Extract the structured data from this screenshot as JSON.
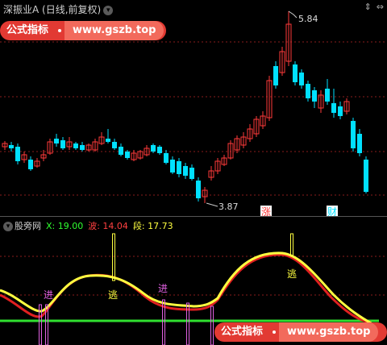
{
  "header": {
    "title": "深振业A (日线,前复权)",
    "chevron": "chevron-down-icon",
    "corner_icons": [
      "collapse-arrows-icon",
      "close-arrows-icon"
    ]
  },
  "promo": {
    "label": "公式指标",
    "url": "www.gszb.top"
  },
  "promo_bottom": {
    "label": "公式指标",
    "url": "www.gszb.top"
  },
  "price_panel": {
    "high_label": "5.84",
    "low_label": "3.87",
    "signals": [
      "涨",
      "财"
    ]
  },
  "indicator": {
    "name": "股旁网",
    "x_label": "X: 19.00",
    "bo_label": "波: 14.04",
    "duan_label": "段: 17.73",
    "marks": [
      "进",
      "逃",
      "进",
      "逃"
    ],
    "colors": {
      "x": "#30ff30",
      "bo": "#ff3030",
      "duan": "#ffff40"
    }
  },
  "colors": {
    "up": "#ff3a3a",
    "down": "#00e0ff",
    "grid": "#8a1d1d",
    "yellow": "#ffff40",
    "red": "#e02020",
    "green": "#30e030",
    "magenta": "#e060e0"
  }
}
